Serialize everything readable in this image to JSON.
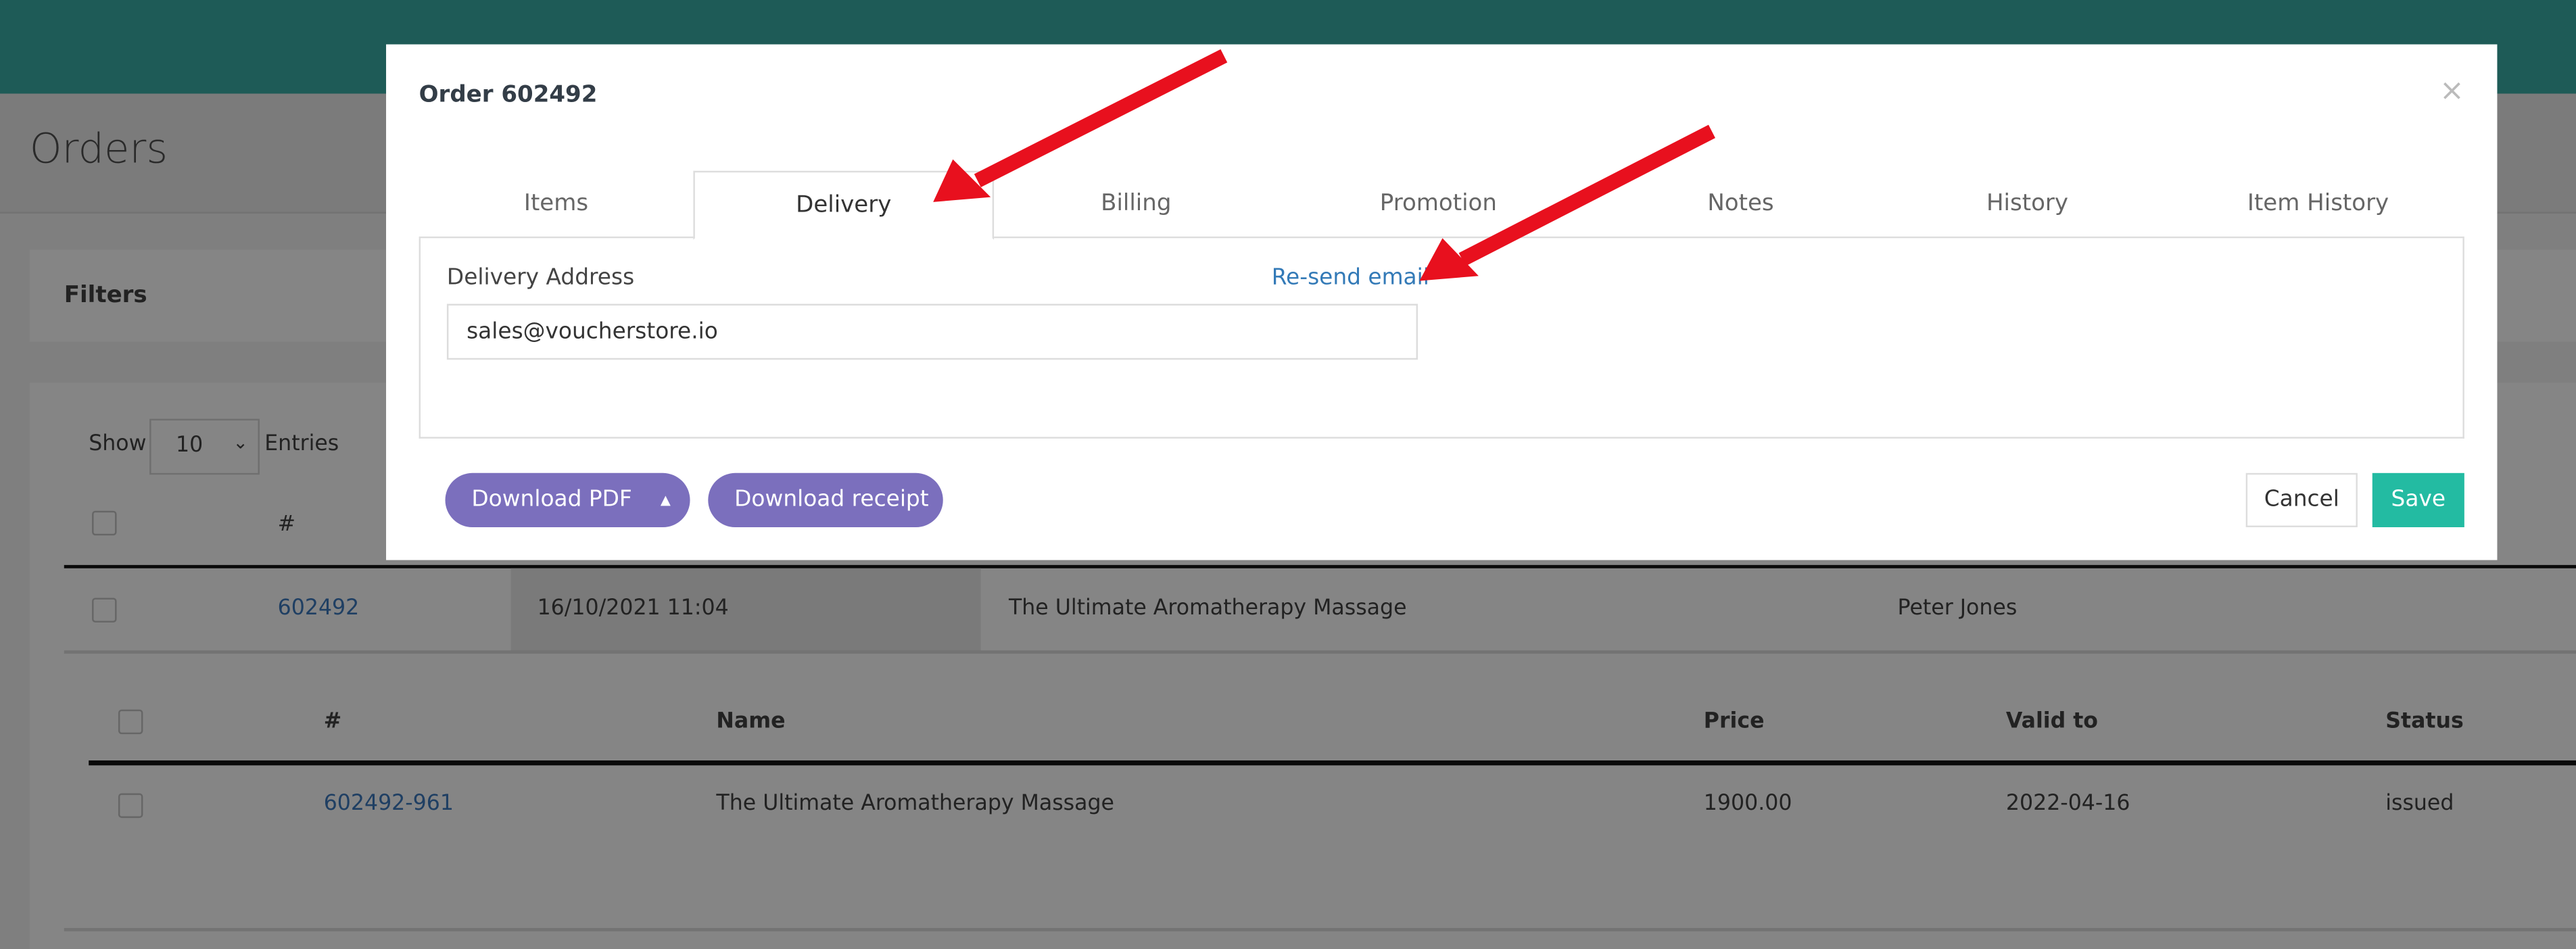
{
  "page": {
    "title": "Orders",
    "filters_label": "Filters",
    "show_label": "Show",
    "entries_label": "Entries",
    "page_size": "10"
  },
  "orders_table": {
    "headers": [
      "#"
    ],
    "rows": [
      {
        "id": "602492",
        "date": "16/10/2021 11:04",
        "name": "The Ultimate Aromatherapy Massage",
        "customer": "Peter Jones"
      }
    ]
  },
  "items_table": {
    "headers": [
      "#",
      "Name",
      "Price",
      "Valid to",
      "Status"
    ],
    "rows": [
      {
        "id": "602492-961",
        "name": "The Ultimate Aromatherapy Massage",
        "price": "1900.00",
        "valid_to": "2022-04-16",
        "status": "issued"
      }
    ]
  },
  "modal": {
    "title": "Order 602492",
    "close": "×",
    "tabs": [
      {
        "label": "Items"
      },
      {
        "label": "Delivery",
        "active": true
      },
      {
        "label": "Billing"
      },
      {
        "label": "Promotion"
      },
      {
        "label": "Notes"
      },
      {
        "label": "History"
      },
      {
        "label": "Item History"
      }
    ],
    "delivery_label": "Delivery Address",
    "resend_label": "Re-send email",
    "delivery_value": "sales@voucherstore.io",
    "download_pdf": "Download PDF",
    "download_receipt": "Download receipt",
    "cancel": "Cancel",
    "save": "Save"
  },
  "colors": {
    "topbar": "#1e5b57",
    "button_purple": "#7b6fbd",
    "save_teal": "#23bba2",
    "link": "#337ab7",
    "annotation_arrow": "#e8101e"
  }
}
